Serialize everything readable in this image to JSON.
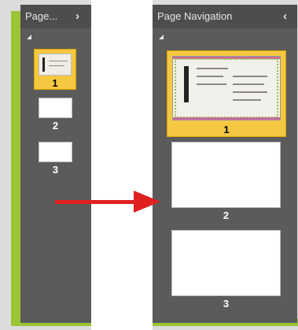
{
  "left_panel": {
    "title": "Page...",
    "chevron": "›",
    "pages": [
      {
        "label": "1"
      },
      {
        "label": "2"
      },
      {
        "label": "3"
      }
    ]
  },
  "right_panel": {
    "title": "Page Navigation",
    "chevron": "‹",
    "pages": [
      {
        "label": "1"
      },
      {
        "label": "2"
      },
      {
        "label": "3"
      }
    ]
  },
  "icons": {
    "collapse": "collapse-triangle-icon",
    "arrow": "red-arrow-icon"
  },
  "colors": {
    "panel": "#5b5b5b",
    "header": "#4d4d4d",
    "selected": "#f5c842",
    "accent_green": "#9bc536",
    "arrow": "#e02020"
  }
}
